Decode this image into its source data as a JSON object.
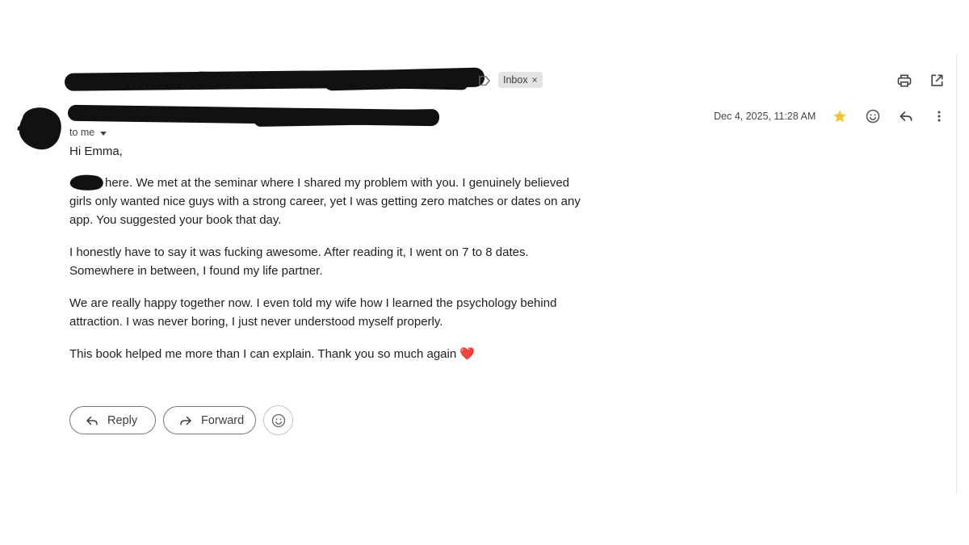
{
  "header": {
    "label_chip": "Inbox",
    "label_chip_close": "×"
  },
  "sender": {
    "recipient_line": "to me",
    "date": "Dec 4, 2025, 11:28 AM",
    "starred": true,
    "star_color": "#f4c430"
  },
  "message": {
    "greeting": "Hi Emma,",
    "paragraphs": [
      "here. We met at the seminar where I shared my problem with you. I genuinely believed girls only wanted nice guys with a strong career, yet I was getting zero matches or dates on any app. You suggested your book that day.",
      "I honestly have to say it was fucking awesome. After reading it, I went on 7 to 8 dates. Somewhere in between, I found my life partner.",
      "We are really happy together now. I even told my wife how I learned the psychology behind attraction. I was never boring, I just never understood myself properly.",
      "This book helped me more than I can explain. Thank you so much again"
    ],
    "closing_emoji": "❤️"
  },
  "actions": {
    "reply_label": "Reply",
    "forward_label": "Forward"
  },
  "icons": {
    "label": "label-outline-icon",
    "print": "print-icon",
    "open_new_window": "open-in-new-icon",
    "star": "star-icon",
    "emoji": "emoji-icon",
    "reply": "reply-icon",
    "more": "more-vert-icon",
    "forward": "forward-icon"
  },
  "colors": {
    "redaction": "#111111",
    "chip_bg": "#e3e3e3",
    "heart": "#e0245e"
  }
}
